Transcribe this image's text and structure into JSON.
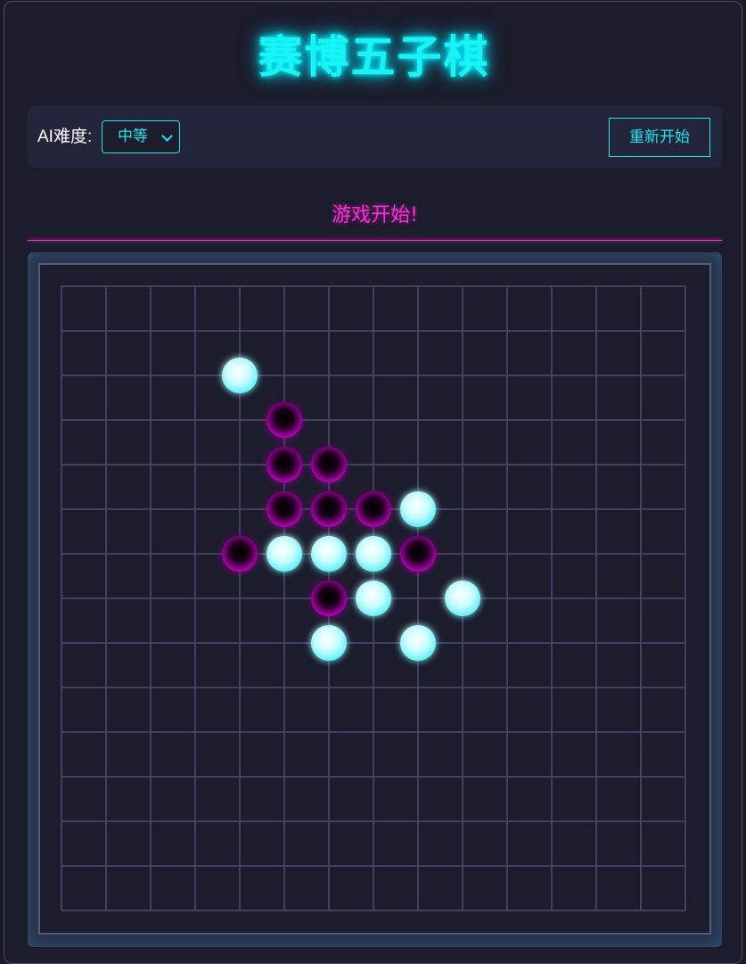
{
  "app": {
    "title": "赛博五子棋"
  },
  "controls": {
    "difficulty_label": "AI难度:",
    "difficulty_value": "中等",
    "restart_label": "重新开始"
  },
  "status": {
    "message": "游戏开始!"
  },
  "colors": {
    "accent_cyan": "#19f3f3",
    "accent_magenta": "#ff2bd6",
    "background": "#1b1c2c"
  },
  "board": {
    "size": 15,
    "stones": [
      {
        "col": 4,
        "row": 2,
        "color": "white"
      },
      {
        "col": 5,
        "row": 3,
        "color": "black"
      },
      {
        "col": 5,
        "row": 4,
        "color": "black"
      },
      {
        "col": 6,
        "row": 4,
        "color": "black"
      },
      {
        "col": 5,
        "row": 5,
        "color": "black"
      },
      {
        "col": 6,
        "row": 5,
        "color": "black"
      },
      {
        "col": 7,
        "row": 5,
        "color": "black"
      },
      {
        "col": 8,
        "row": 5,
        "color": "white"
      },
      {
        "col": 4,
        "row": 6,
        "color": "black"
      },
      {
        "col": 5,
        "row": 6,
        "color": "white"
      },
      {
        "col": 6,
        "row": 6,
        "color": "white"
      },
      {
        "col": 7,
        "row": 6,
        "color": "white"
      },
      {
        "col": 8,
        "row": 6,
        "color": "black"
      },
      {
        "col": 6,
        "row": 7,
        "color": "black"
      },
      {
        "col": 7,
        "row": 7,
        "color": "white"
      },
      {
        "col": 9,
        "row": 7,
        "color": "white"
      },
      {
        "col": 6,
        "row": 8,
        "color": "white"
      },
      {
        "col": 8,
        "row": 8,
        "color": "white"
      }
    ]
  }
}
